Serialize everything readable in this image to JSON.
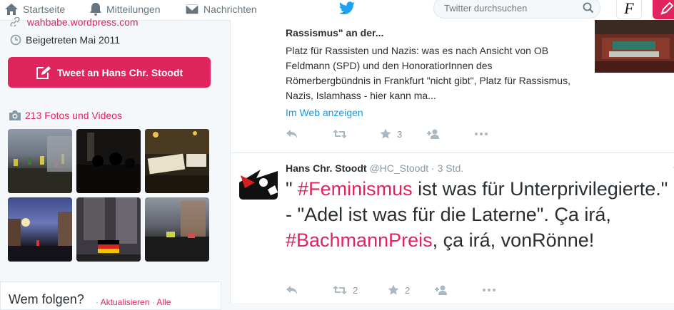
{
  "nav": {
    "home": "Startseite",
    "notifications": "Mitteilungen",
    "messages": "Nachrichten"
  },
  "search": {
    "placeholder": "Twitter durchsuchen"
  },
  "profile": {
    "website": "wahbabe.wordpress.com",
    "joined": "Beigetreten Mai 2011",
    "tweet_to": "Tweet an Hans Chr. Stoodt",
    "photos_link": "213 Fotos und Videos"
  },
  "who_to_follow": {
    "title": "Wem folgen?",
    "refresh": "Aktualisieren",
    "all": "Alle"
  },
  "card_tweet": {
    "title": "Rassismus\" an der...",
    "description": "Platz für Rassisten und Nazis: was es nach Ansicht von OB Feldmann (SPD) und den HonoratiorInnen des Römerbergbündnis in Frankfurt \"nicht gibt\", Platz für Rassismus, Nazis, Islamhass - hier kann ma...",
    "link": "Im Web anzeigen",
    "retweets": "",
    "likes": "3"
  },
  "tweet": {
    "name": "Hans Chr. Stoodt",
    "handle": "@HC_Stoodt",
    "dot": "·",
    "time": "3 Std.",
    "text_part1": "\" ",
    "hashtag1": "#Feminismus",
    "text_part2": " ist was für Unterprivilegierte.\" - \"Adel ist was für die Laterne\". Ça irá, ",
    "hashtag2": "#BachmannPreis",
    "text_part3": ", ça irá, vonRönne!",
    "retweets": "2",
    "likes": "2"
  },
  "colors": {
    "accent": "#e0245e",
    "link": "#1b95e0",
    "muted": "#8899a6",
    "twitter_blue": "#1da1f2"
  },
  "icons": [
    "home-icon",
    "bell-icon",
    "envelope-icon",
    "twitter-bird-icon",
    "search-icon",
    "link-icon",
    "clock-icon",
    "compose-icon",
    "camera-icon",
    "reply-icon",
    "retweet-icon",
    "star-icon",
    "follow-icon",
    "more-icon"
  ]
}
